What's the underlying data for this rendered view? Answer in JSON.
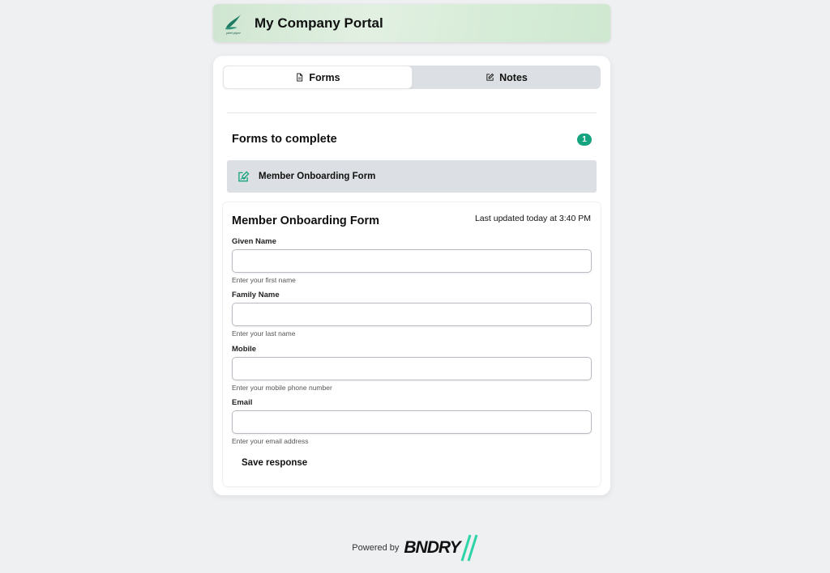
{
  "header": {
    "logo_text": "pied piper",
    "title": "My Company Portal"
  },
  "tabs": [
    {
      "label": "Forms",
      "icon": "file-icon",
      "active": true
    },
    {
      "label": "Notes",
      "icon": "edit-icon",
      "active": false
    }
  ],
  "forms_section": {
    "title": "Forms to complete",
    "count": "1",
    "items": [
      {
        "label": "Member Onboarding Form",
        "icon": "form-edit-icon"
      }
    ]
  },
  "form": {
    "title": "Member Onboarding Form",
    "updated": "Last updated today at 3:40 PM",
    "fields": [
      {
        "label": "Given Name",
        "value": "",
        "help": "Enter your first name"
      },
      {
        "label": "Family Name",
        "value": "",
        "help": "Enter your last name"
      },
      {
        "label": "Mobile",
        "value": "",
        "help": "Enter your mobile phone number"
      },
      {
        "label": "Email",
        "value": "",
        "help": "Enter your email address"
      }
    ],
    "save_label": "Save response"
  },
  "footer": {
    "powered_by": "Powered by",
    "brand": "BNDRY"
  },
  "colors": {
    "accent": "#16a37f",
    "brand_stripe": "#2dd4a7"
  }
}
